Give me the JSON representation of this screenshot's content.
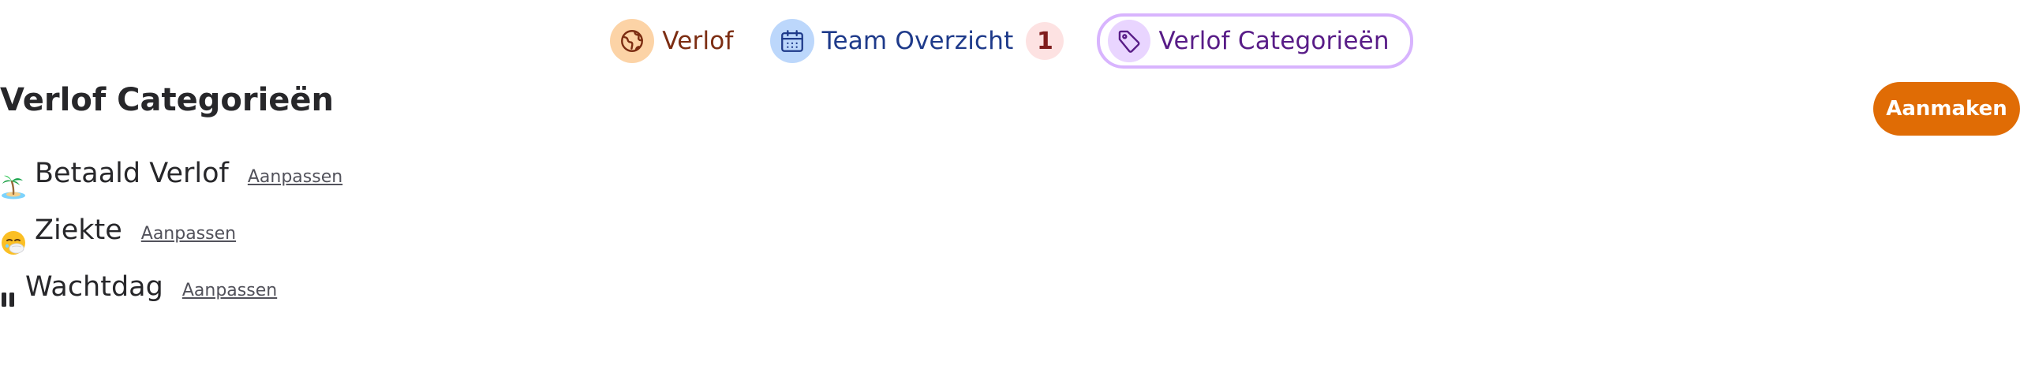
{
  "tabs": [
    {
      "label": "Verlof",
      "icon": "globe-icon"
    },
    {
      "label": "Team Overzicht",
      "icon": "calendar-icon",
      "badge": "1"
    },
    {
      "label": "Verlof Categorieën",
      "icon": "tag-icon",
      "active": true
    }
  ],
  "header": {
    "title": "Verlof Categorieën",
    "create_label": "Aanmaken"
  },
  "categories": [
    {
      "emoji": "island-icon",
      "name": "Betaald Verlof",
      "edit_label": "Aanpassen"
    },
    {
      "emoji": "sick-face-icon",
      "name": "Ziekte",
      "edit_label": "Aanpassen"
    },
    {
      "emoji": "pause-icon",
      "name": "Wachtdag",
      "edit_label": "Aanpassen"
    }
  ],
  "colors": {
    "accent": "#e06c05",
    "tab_leave_bg": "#fcd3a6",
    "tab_team_bg": "#bcd7fb",
    "tab_categories_bg": "#e9d5ff",
    "tab_categories_border": "#d8b4fe",
    "badge_bg": "#fde2e2"
  }
}
